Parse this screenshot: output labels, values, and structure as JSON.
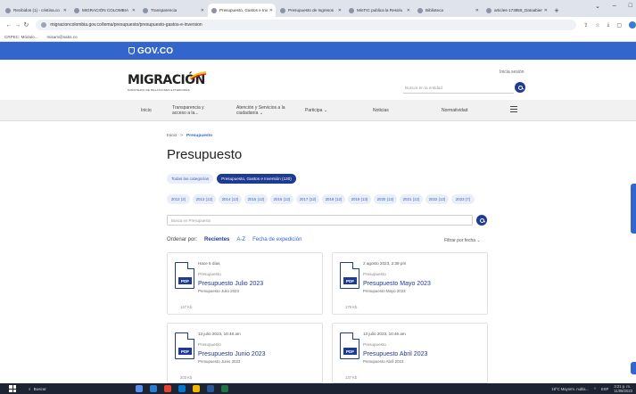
{
  "browser": {
    "tabs": [
      {
        "label": "Recibidos (1) - cristina.co"
      },
      {
        "label": "MIGRACIÓN COLOMBIA"
      },
      {
        "label": "Transparencia"
      },
      {
        "label": "Presupuesto, Gastos e Inv"
      },
      {
        "label": "Presupuesto de Ingresos"
      },
      {
        "label": "MinTIC publica la Resolu"
      },
      {
        "label": "Biblioteca"
      },
      {
        "label": "articles-173859_Datoabier"
      }
    ],
    "active_tab": 3,
    "new_tab": "+",
    "url": "migracioncolombia.gov.co/tema/presupuesto/presupuesto-gastos-e-inversion",
    "bookmarks": [
      "CRPEC: Módulo...",
      "misam@sabs.co"
    ]
  },
  "gov": {
    "label": "GOV.CO"
  },
  "header": {
    "brand": "MIGRACIÓN",
    "brand_sub": "MINISTERIO DE RELACIONES EXTERIORES",
    "login": "Inicia sesión",
    "search_placeholder": "Buscar en la entidad"
  },
  "nav": {
    "items": [
      {
        "label": "Inicio"
      },
      {
        "label": "Transparencia y acceso a la..."
      },
      {
        "label": "Atención y Servicios a la ciudadanía ⌄"
      },
      {
        "label": "Participa ⌄"
      },
      {
        "label": "Noticias"
      },
      {
        "label": "Normatividad"
      }
    ]
  },
  "breadcrumb": {
    "home": "Inicio",
    "sep": ">",
    "current": "Presupuesto"
  },
  "page_title": "Presupuesto",
  "categories": [
    {
      "label": "Todas las categorías",
      "active": false
    },
    {
      "label": "Presupuesto, Gastos e Inversión (130)",
      "active": true
    }
  ],
  "years": [
    "2012 (2)",
    "2013 (12)",
    "2014 (12)",
    "2015 (12)",
    "2016 (12)",
    "2017 (12)",
    "2018 (12)",
    "2019 (13)",
    "2020 (12)",
    "2021 (12)",
    "2022 (12)",
    "2023 (7)"
  ],
  "filter": {
    "placeholder": "Busca en Presupuesto"
  },
  "order": {
    "label": "Ordenar por:",
    "options": [
      "Recientes",
      "A-Z",
      "Fecha de expedición"
    ],
    "filter_by_date": "Filtrar por fecha ⌄"
  },
  "cards": [
    {
      "date": "Hace 5 días",
      "category": "Presupuesto",
      "title": "Presupuesto Julio 2023",
      "subtitle": "Presupuesto Julio 2023",
      "size": "147 Kb",
      "badge": "PDF"
    },
    {
      "date": "2 agosto 2023, 2:39 pm",
      "category": "Presupuesto",
      "title": "Presupuesto Mayo 2023",
      "subtitle": "Presupuesto Mayo 2023",
      "size": "179 Kb",
      "badge": "PDF"
    },
    {
      "date": "13 julio 2023, 10:48 am",
      "category": "Presupuesto",
      "title": "Presupuesto Junio 2023",
      "subtitle": "Presupuesto Junio 2023",
      "size": "203 Kb",
      "badge": "PDF"
    },
    {
      "date": "13 julio 2023, 10:46 am",
      "category": "Presupuesto",
      "title": "Presupuesto Abril 2023",
      "subtitle": "Presupuesto Abril 2023",
      "size": "137 Kb",
      "badge": "PDF"
    }
  ],
  "taskbar": {
    "search": "Buscar",
    "weather": "19°C Mayorm. nubla...",
    "lang": "ESP",
    "time": "3:21 p. m.",
    "date": "11/08/2023"
  },
  "colors": {
    "gov_blue": "#3366cc",
    "navy": "#1f3a93"
  }
}
